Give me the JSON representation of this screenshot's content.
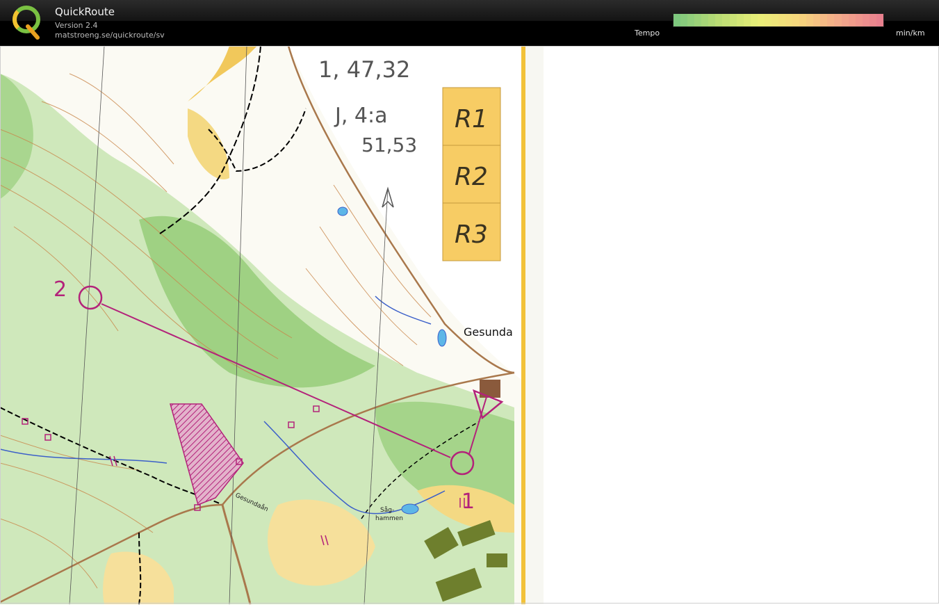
{
  "app": {
    "title": "QuickRoute",
    "version": "Version 2.4",
    "url": "matstroeng.se/quickroute/sv",
    "logo_letter": "Q"
  },
  "legend": {
    "tempo_label": "Tempo",
    "unit_label": "min/km",
    "gradient_colors": [
      "#7ec87e",
      "#b8db74",
      "#e9ef78",
      "#f6d67c",
      "#f3a98a",
      "#e8808e"
    ]
  },
  "map": {
    "place_name": "Gesunda",
    "map_label_river": "Gesundaån",
    "map_label_sag": "Såg-",
    "map_label_hammen": "hammen",
    "handwriting_line1": "1, 47,32",
    "handwriting_line2": "J, 4:a",
    "handwriting_line3": "51,53",
    "control_2": "2",
    "control_1": "1",
    "boxes": [
      "R1",
      "R2",
      "R3"
    ]
  },
  "colors": {
    "course": "#b3227a",
    "forest_light": "#c6e3b0",
    "forest_dark": "#8dc86d",
    "yellow": "#f4d983"
  }
}
